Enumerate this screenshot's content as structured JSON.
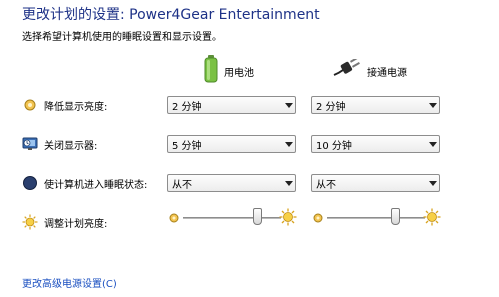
{
  "header": {
    "title": "更改计划的设置: Power4Gear Entertainment",
    "subtitle": "选择希望计算机使用的睡眠设置和显示设置。"
  },
  "columns": {
    "battery": {
      "label": "用电池",
      "icon": "battery-icon"
    },
    "plugged_in": {
      "label": "接通电源",
      "icon": "power-plug-icon"
    }
  },
  "settings": {
    "dim_display": {
      "label": "降低显示亮度:",
      "icon": "dim-display-icon",
      "battery_value": "2 分钟",
      "plugged_value": "2 分钟"
    },
    "turn_off_display": {
      "label": "关闭显示器:",
      "icon": "display-icon",
      "battery_value": "5 分钟",
      "plugged_value": "10 分钟"
    },
    "sleep": {
      "label": "使计算机进入睡眠状态:",
      "icon": "sleep-icon",
      "battery_value": "从不",
      "plugged_value": "从不"
    },
    "brightness": {
      "label": "调整计划亮度:",
      "icon": "brightness-icon",
      "battery_level": 0.76,
      "plugged_level": 0.7
    }
  },
  "links": {
    "advanced": "更改高级电源设置(C)"
  },
  "colors": {
    "title": "#1e3287",
    "link": "#1a4fc0"
  }
}
